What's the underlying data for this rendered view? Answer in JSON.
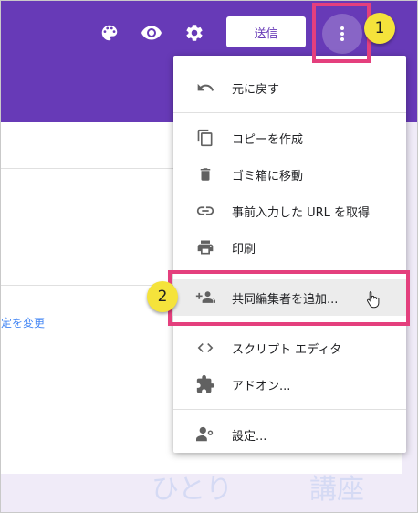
{
  "toolbar": {
    "send_label": "送信",
    "icons": [
      "palette-icon",
      "eye-icon",
      "gear-icon",
      "more-vert-icon"
    ]
  },
  "background": {
    "link_fragment": "定を変更"
  },
  "menu": {
    "items": [
      {
        "label": "元に戻す",
        "icon": "undo-icon"
      },
      {
        "label": "コピーを作成",
        "icon": "copy-icon"
      },
      {
        "label": "ゴミ箱に移動",
        "icon": "trash-icon"
      },
      {
        "label": "事前入力した URL を取得",
        "icon": "link-icon"
      },
      {
        "label": "印刷",
        "icon": "print-icon"
      },
      {
        "label": "共同編集者を追加...",
        "icon": "add-people-icon"
      },
      {
        "label": "スクリプト エディタ",
        "icon": "code-icon"
      },
      {
        "label": "アドオン...",
        "icon": "puzzle-icon"
      },
      {
        "label": "設定...",
        "icon": "person-settings-icon"
      }
    ]
  },
  "annotations": {
    "step1": "1",
    "step2": "2",
    "highlight_color": "#e43f7d",
    "badge_color": "#f5e33b"
  },
  "watermark": {
    "left": "ひとり",
    "right": "講座"
  },
  "colors": {
    "header": "#673ab7",
    "page_bg": "#f0ebf8"
  }
}
